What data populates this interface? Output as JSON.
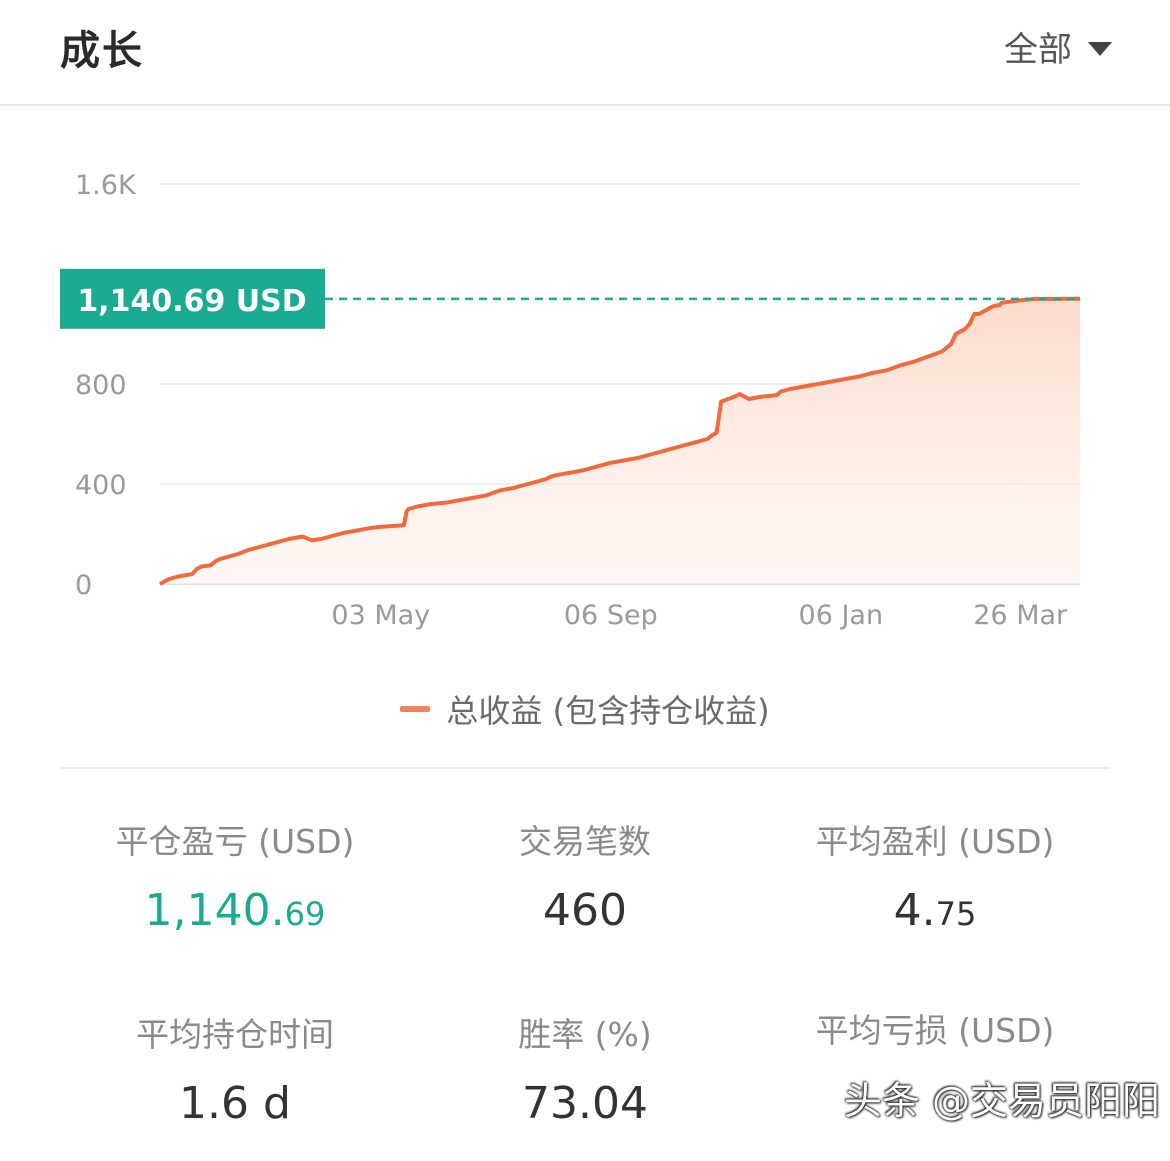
{
  "header": {
    "title": "成长",
    "filter_label": "全部"
  },
  "chart_data": {
    "type": "area",
    "title": "",
    "xlabel": "",
    "ylabel": "",
    "y_ticks": [
      "0",
      "400",
      "800",
      "1.6K"
    ],
    "y_tick_values": [
      0,
      400,
      800,
      1600
    ],
    "ylim": [
      0,
      1600
    ],
    "x_ticks": [
      "03 May",
      "06 Sep",
      "06 Jan",
      "26 Mar"
    ],
    "x_tick_positions": [
      48,
      98,
      148,
      187
    ],
    "xlim": [
      0,
      200
    ],
    "grid": true,
    "legend_position": "bottom",
    "current_label": "1,140.69 USD",
    "current_value": 1140.69,
    "colors": {
      "line": "#f26a3c",
      "fill": "#fde3d8",
      "badge": "#1aab93",
      "grid": "#eeeeee"
    },
    "series": [
      {
        "name": "总收益 (包含持仓收益)",
        "x": [
          0,
          2,
          4,
          7,
          8,
          9,
          11,
          12,
          13,
          14,
          15,
          17,
          19,
          22,
          25,
          28,
          31,
          33,
          35,
          37,
          40,
          43,
          46,
          49,
          53,
          53.6,
          54,
          56,
          59,
          62,
          65,
          68,
          71,
          74,
          77,
          78,
          80,
          84,
          85,
          86,
          89,
          92,
          95,
          98,
          101,
          104,
          107,
          110,
          113,
          116,
          119,
          120,
          121,
          122,
          125,
          126,
          128,
          131,
          134,
          135,
          137,
          140,
          143,
          146,
          149,
          152,
          155,
          158,
          161,
          164,
          167,
          170,
          172,
          173,
          175,
          176,
          176.5,
          177,
          178,
          180,
          181,
          182,
          182.5,
          183,
          185,
          187,
          190,
          200
        ],
        "values": [
          0,
          20,
          30,
          40,
          60,
          70,
          75,
          90,
          100,
          105,
          110,
          120,
          135,
          150,
          165,
          180,
          190,
          175,
          180,
          190,
          205,
          215,
          225,
          230,
          235,
          290,
          300,
          310,
          320,
          325,
          335,
          345,
          355,
          375,
          385,
          390,
          400,
          420,
          430,
          435,
          445,
          455,
          470,
          485,
          495,
          505,
          520,
          535,
          550,
          565,
          580,
          595,
          605,
          730,
          750,
          760,
          740,
          750,
          755,
          770,
          780,
          790,
          800,
          810,
          820,
          830,
          845,
          855,
          875,
          890,
          910,
          930,
          960,
          1000,
          1020,
          1040,
          1060,
          1080,
          1080,
          1100,
          1110,
          1115,
          1115,
          1125,
          1130,
          1135,
          1140,
          1140.69
        ]
      }
    ]
  },
  "stats": {
    "closed_pnl": {
      "label": "平仓盈亏 (USD)",
      "value_main": "1,140.",
      "value_small": "69"
    },
    "trade_count": {
      "label": "交易笔数",
      "value": "460"
    },
    "avg_profit": {
      "label": "平均盈利 (USD)",
      "value_main": "4.",
      "value_small": "75"
    },
    "avg_holding_time": {
      "label": "平均持仓时间",
      "value": "1.6 d"
    },
    "win_rate": {
      "label": "胜率 (%)",
      "value": "73.04"
    },
    "avg_loss": {
      "label": "平均亏损 (USD)"
    }
  },
  "watermark": {
    "text": "头条 @交易员阳阳"
  }
}
